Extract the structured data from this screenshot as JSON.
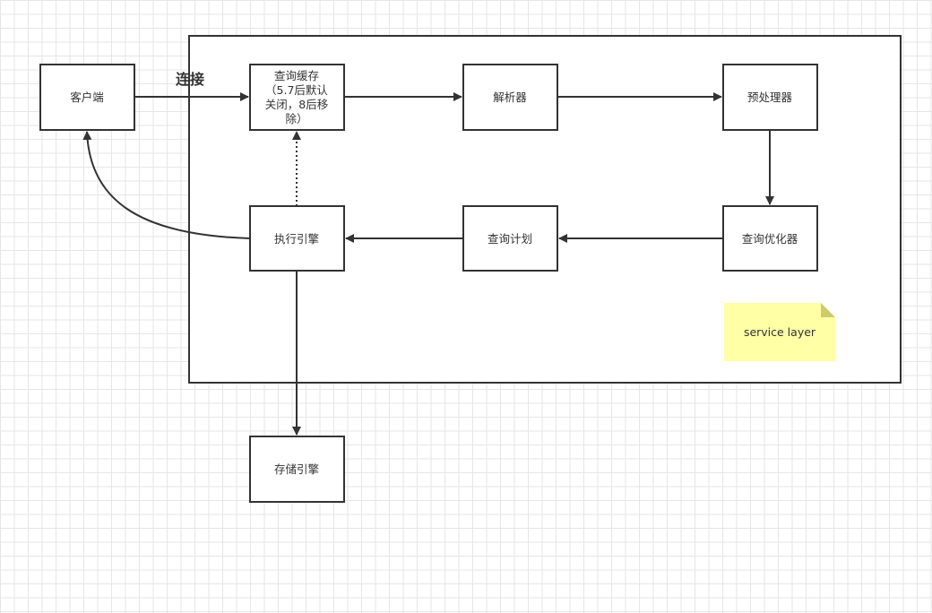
{
  "container": {
    "name": ""
  },
  "nodes": {
    "client": "客户端",
    "cache": [
      "查询缓存",
      "（5.7后默认",
      "关闭，8后移",
      "除）"
    ],
    "parser": "解析器",
    "preprocessor": "预处理器",
    "optimizer": "查询优化器",
    "plan": "查询计划",
    "executor": "执行引擎",
    "storage": "存储引擎"
  },
  "edge_labels": {
    "connect": "连接"
  },
  "note": {
    "text": "service layer",
    "color": "#ffffa6"
  },
  "colors": {
    "stroke": "#333333",
    "grid": "#e6e6e6"
  }
}
